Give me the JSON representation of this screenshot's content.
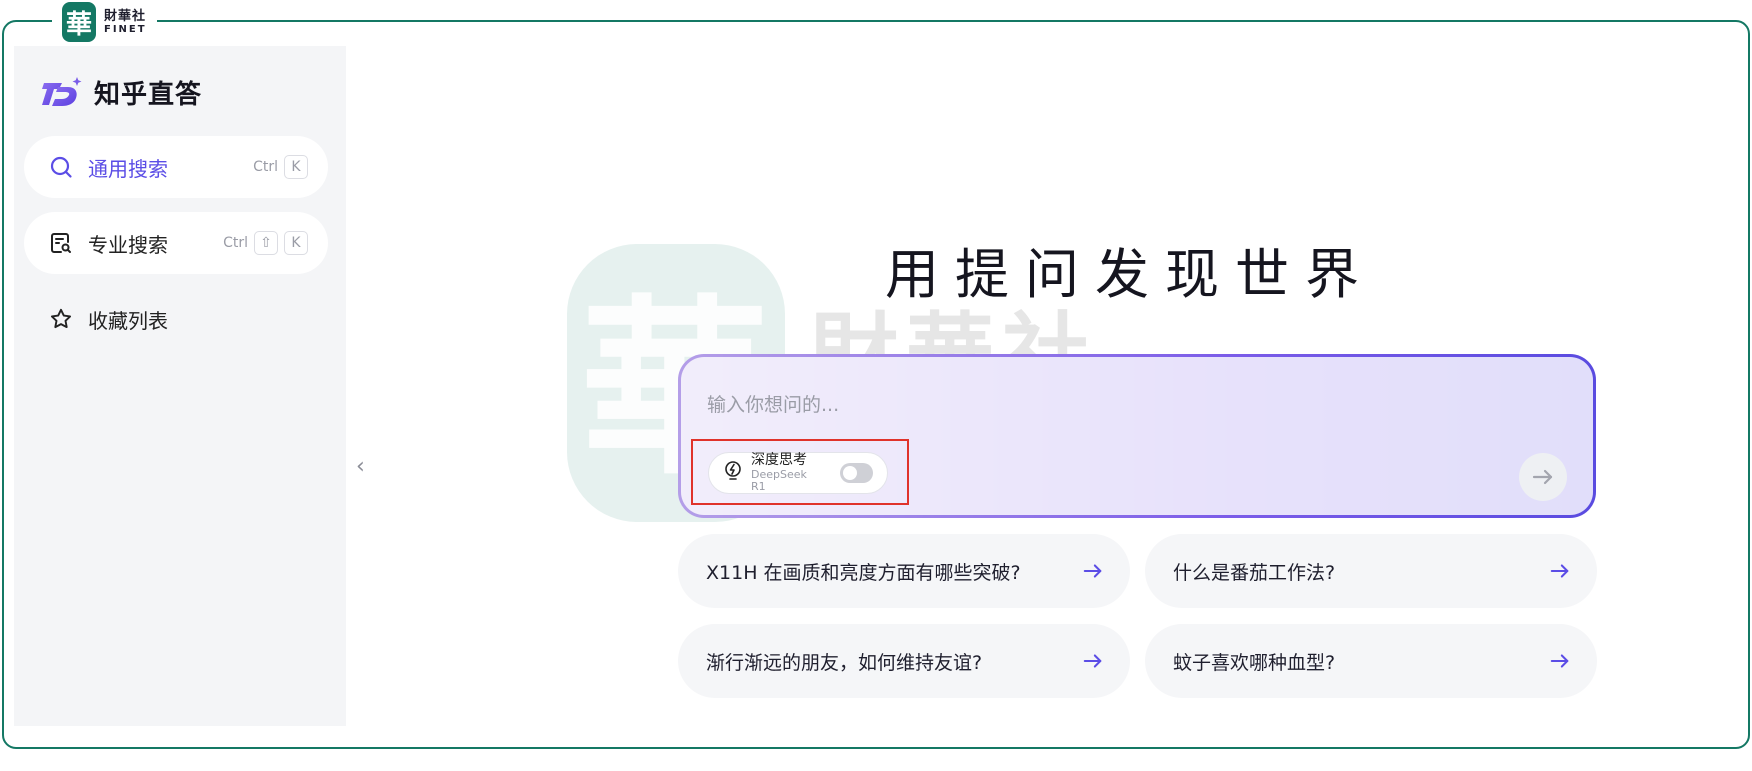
{
  "brand": {
    "seal_char": "華",
    "name_cn": "財華社",
    "name_en": "FINET"
  },
  "sidebar": {
    "logo_title": "知乎直答",
    "items": [
      {
        "label": "通用搜索",
        "icon": "search-icon",
        "shortcut": [
          "Ctrl",
          "K"
        ],
        "active": true
      },
      {
        "label": "专业搜索",
        "icon": "pro-search-icon",
        "shortcut": [
          "Ctrl",
          "⇧",
          "K"
        ],
        "active": false
      },
      {
        "label": "收藏列表",
        "icon": "star-icon",
        "shortcut": [],
        "active": false
      }
    ],
    "collapse_glyph": "‹"
  },
  "main": {
    "hero_title": "用提问发现世界",
    "search": {
      "placeholder": "输入你想问的...",
      "value": "",
      "deep_think": {
        "title": "深度思考",
        "subtitle": "DeepSeek R1",
        "enabled": false
      }
    },
    "suggestions": [
      "X11H 在画质和亮度方面有哪些突破?",
      "什么是番茄工作法?",
      "渐行渐远的朋友，如何维持友谊?",
      "蚊子喜欢哪种血型?"
    ]
  },
  "watermark": {
    "seal_char": "華",
    "name_cn": "財華社",
    "name_en": "FINET"
  },
  "colors": {
    "frame_green": "#147864",
    "accent_purple": "#5b4de6",
    "highlight_red": "#e0332b"
  }
}
